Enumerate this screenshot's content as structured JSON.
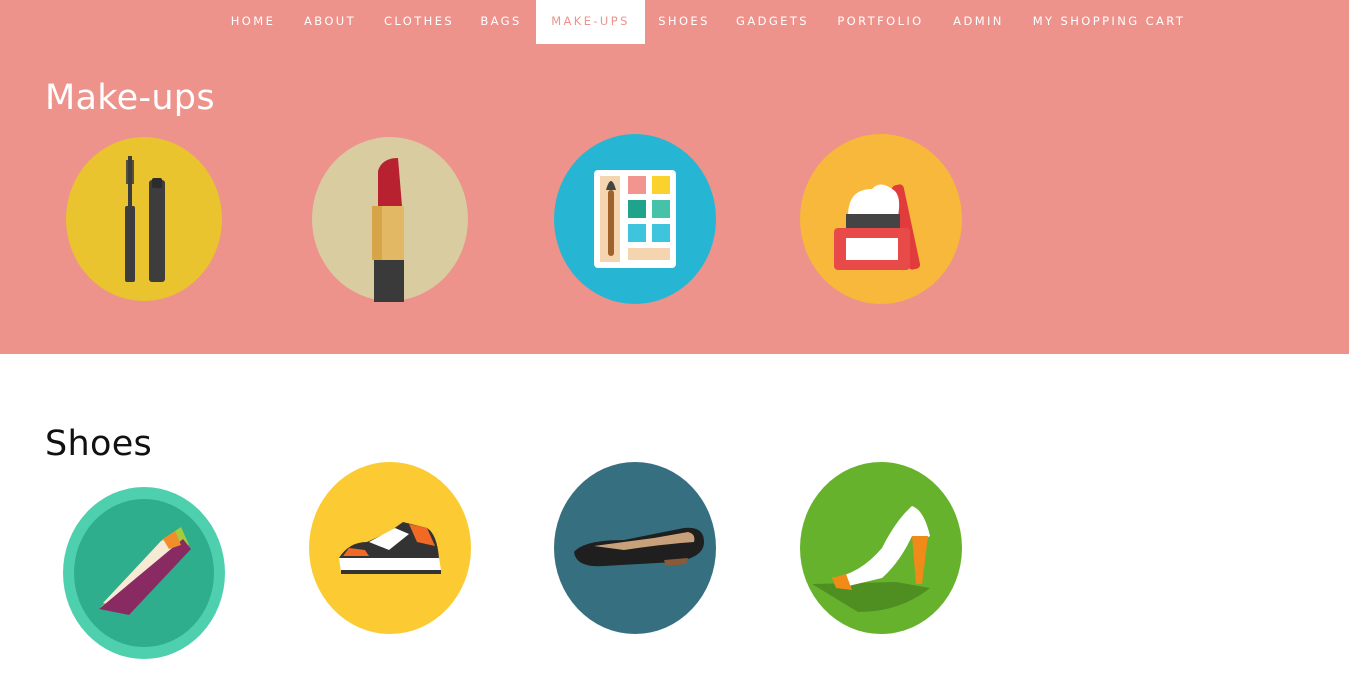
{
  "nav": {
    "items": [
      {
        "label": "HOME"
      },
      {
        "label": "ABOUT"
      },
      {
        "label": "CLOTHES"
      },
      {
        "label": "BAGS"
      },
      {
        "label": "MAKE-UPS",
        "active": true
      },
      {
        "label": "SHOES"
      },
      {
        "label": "GADGETS"
      },
      {
        "label": "PORTFOLIO"
      },
      {
        "label": "ADMIN"
      },
      {
        "label": "MY SHOPPING CART"
      }
    ]
  },
  "sections": [
    {
      "title": "Make-ups",
      "background": "#ee928c",
      "products": [
        {
          "icon": "mascara-icon",
          "circle_color": "#e9c42f"
        },
        {
          "icon": "lipstick-icon",
          "circle_color": "#d9cca1"
        },
        {
          "icon": "eyeshadow-palette-icon",
          "circle_color": "#26b6d4"
        },
        {
          "icon": "cream-jar-icon",
          "circle_color": "#f7b83b"
        }
      ]
    },
    {
      "title": "Shoes",
      "background": "#ffffff",
      "products": [
        {
          "icon": "running-shoe-icon",
          "circle_color": "#4ecfae"
        },
        {
          "icon": "sneaker-icon",
          "circle_color": "#fccb33"
        },
        {
          "icon": "flat-shoe-icon",
          "circle_color": "#366f80"
        },
        {
          "icon": "high-heel-icon",
          "circle_color": "#67b22d"
        }
      ]
    }
  ]
}
